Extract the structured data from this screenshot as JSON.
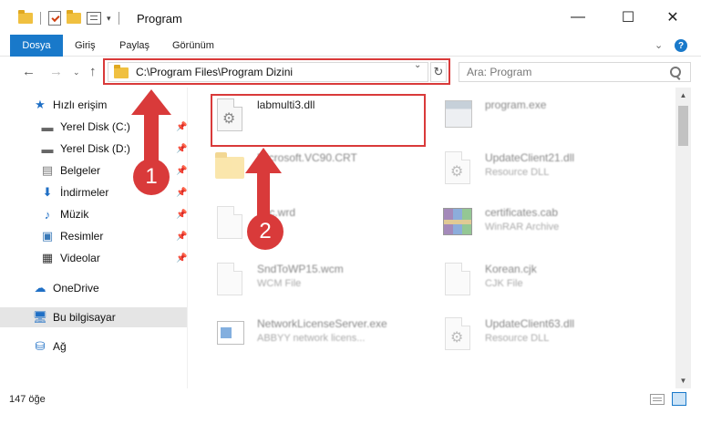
{
  "window": {
    "title": "Program",
    "minimize": "—",
    "maximize": "☐",
    "close": "✕"
  },
  "ribbon": {
    "tabs": [
      "Dosya",
      "Giriş",
      "Paylaş",
      "Görünüm"
    ],
    "help": "?"
  },
  "navigation": {
    "address": "C:\\Program Files\\Program Dizini",
    "search_placeholder": "Ara: Program"
  },
  "sidebar": {
    "items": [
      {
        "label": "Hızlı erişim",
        "icon": "star-icon"
      },
      {
        "label": "Yerel Disk (C:)",
        "icon": "drive-icon"
      },
      {
        "label": "Yerel Disk (D:)",
        "icon": "drive-icon"
      },
      {
        "label": "Belgeler",
        "icon": "documents-icon"
      },
      {
        "label": "İndirmeler",
        "icon": "download-icon"
      },
      {
        "label": "Müzik",
        "icon": "music-icon"
      },
      {
        "label": "Resimler",
        "icon": "pictures-icon"
      },
      {
        "label": "Videolar",
        "icon": "videos-icon"
      },
      {
        "label": "OneDrive",
        "icon": "cloud-icon"
      },
      {
        "label": "Bu bilgisayar",
        "icon": "computer-icon"
      },
      {
        "label": "Ağ",
        "icon": "network-icon"
      }
    ]
  },
  "files": [
    {
      "name": "labmulti3.dll",
      "sub": "",
      "icon": "dll-gear-icon"
    },
    {
      "name": "program.exe",
      "sub": "",
      "icon": "app-icon"
    },
    {
      "name": "Microsoft.VC90.CRT",
      "sub": "",
      "icon": "folder-icon"
    },
    {
      "name": "UpdateClient21.dll",
      "sub": "Resource DLL",
      "icon": "dll-gear-icon"
    },
    {
      "name": "abc.wrd",
      "sub": "",
      "icon": "document-icon"
    },
    {
      "name": "certificates.cab",
      "sub": "WinRAR Archive",
      "icon": "archive-icon"
    },
    {
      "name": "SndToWP15.wcm",
      "sub": "WCM File",
      "icon": "document-icon"
    },
    {
      "name": "Korean.cjk",
      "sub": "CJK File",
      "icon": "document-icon"
    },
    {
      "name": "NetworkLicenseServer.exe",
      "sub": "ABBYY network licens...",
      "icon": "app-icon"
    },
    {
      "name": "UpdateClient63.dll",
      "sub": "Resource DLL",
      "icon": "dll-gear-icon"
    }
  ],
  "status": {
    "item_count": "147 öğe"
  },
  "annotations": {
    "step1": "1",
    "step2": "2",
    "color": "#d93a3a"
  }
}
